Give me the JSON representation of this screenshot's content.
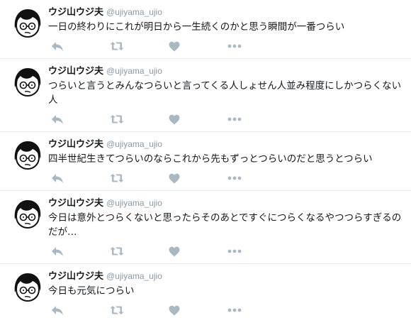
{
  "colors": {
    "text": "#14171a",
    "secondary": "#8899a6",
    "icon": "#aab8c2",
    "divider": "#e6ecf0"
  },
  "tweets": [
    {
      "fullname": "ウジ山ウジ夫",
      "username": "@ujiyama_ujio",
      "text": "一日の終わりにこれが明日から一生続くのかと思う瞬間が一番つらい",
      "icons": [
        "reply-icon",
        "retweet-icon",
        "like-heart-icon",
        "more-options-icon"
      ]
    },
    {
      "fullname": "ウジ山ウジ夫",
      "username": "@ujiyama_ujio",
      "text": "つらいと言うとみんなつらいと言ってくる人しょせん人並み程度にしかつらくない人",
      "icons": [
        "reply-icon",
        "retweet-icon",
        "like-heart-icon",
        "more-options-icon"
      ]
    },
    {
      "fullname": "ウジ山ウジ夫",
      "username": "@ujiyama_ujio",
      "text": "四半世紀生きてつらいのならこれから先もずっとつらいのだと思うとつらい",
      "icons": [
        "reply-icon",
        "retweet-icon",
        "like-heart-icon",
        "more-options-icon"
      ]
    },
    {
      "fullname": "ウジ山ウジ夫",
      "username": "@ujiyama_ujio",
      "text": "今日は意外とつらくないと思ったらそのあとですぐにつらくなるやつつらすぎるのだが…",
      "icons": [
        "reply-icon",
        "retweet-icon",
        "like-heart-icon",
        "more-options-icon"
      ]
    },
    {
      "fullname": "ウジ山ウジ夫",
      "username": "@ujiyama_ujio",
      "text": "今日も元気につらい",
      "icons": [
        "reply-icon",
        "retweet-icon",
        "like-heart-icon",
        "more-options-icon"
      ]
    }
  ]
}
